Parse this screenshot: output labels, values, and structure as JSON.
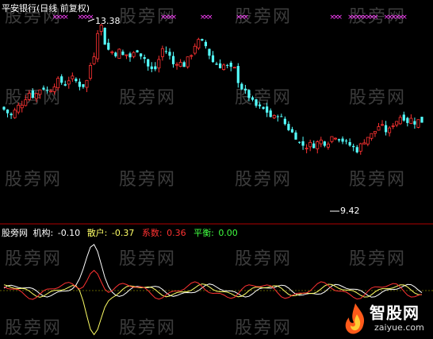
{
  "upper_header": {
    "title": "平安银行(日线 前复权)",
    "color": "#ffffff"
  },
  "annotations": {
    "high": "13.38",
    "low": "9.42"
  },
  "lower_header": {
    "name": "股旁网",
    "jigou_label": "机构:",
    "jigou_value": "-0.10",
    "sanhu_label": "散户:",
    "sanhu_value": "-0.37",
    "xishu_label": "系数:",
    "xishu_value": "0.36",
    "pingheng_label": "平衡:",
    "pingheng_value": "0.00"
  },
  "watermark_text": "股旁网",
  "logo": {
    "title": "智股网",
    "url": "zaiyue.com"
  },
  "colors": {
    "background": "#000000",
    "up": "#ff3232",
    "down": "#54ffff",
    "divider": "#b00000",
    "marker": "#ff40ff",
    "jigou": "#ffffff",
    "sanhu": "#ffff66",
    "xishu": "#ff3232",
    "pingheng": "#40ff40",
    "zero_line": "#c0c000"
  },
  "chart_data": [
    {
      "type": "candlestick",
      "title": "平安银行(日线 前复权)",
      "high_label": 13.38,
      "low_label": 9.42,
      "close_path": [
        11.55,
        11.48,
        11.42,
        11.52,
        11.62,
        11.68,
        11.8,
        11.9,
        11.84,
        11.88,
        11.98,
        12.0,
        11.94,
        11.98,
        12.08,
        12.15,
        12.12,
        12.08,
        12.18,
        12.2,
        12.14,
        12.06,
        12.05,
        12.15,
        12.48,
        12.7,
        13.2,
        13.3,
        12.95,
        12.8,
        12.76,
        12.72,
        12.78,
        12.68,
        12.7,
        12.65,
        12.72,
        12.8,
        12.7,
        12.62,
        12.45,
        12.38,
        12.4,
        12.6,
        12.82,
        12.78,
        12.66,
        12.5,
        12.55,
        12.52,
        12.48,
        12.6,
        12.72,
        12.9,
        12.98,
        12.95,
        12.88,
        12.7,
        12.55,
        12.5,
        12.46,
        12.48,
        12.45,
        12.4,
        12.4,
        12.15,
        12.0,
        11.9,
        11.82,
        11.7,
        11.62,
        11.58,
        11.55,
        11.5,
        11.4,
        11.38,
        11.45,
        11.36,
        11.25,
        11.15,
        11.06,
        10.98,
        10.85,
        10.8,
        10.78,
        10.82,
        10.8,
        10.86,
        10.9,
        10.85,
        10.88,
        10.98,
        11.0,
        10.95,
        10.9,
        10.85,
        10.8,
        10.75,
        10.7,
        10.8,
        10.9,
        10.98,
        11.02,
        11.1,
        11.2,
        11.18,
        11.1,
        11.12,
        11.25,
        11.32,
        11.4,
        11.38,
        11.3,
        11.35,
        11.28,
        11.32,
        11.3
      ],
      "markers_top": "purple x markers along the top edge",
      "panel": "upper"
    },
    {
      "type": "line",
      "series": [
        {
          "name": "机构",
          "color": "#ffffff",
          "last_value": -0.1
        },
        {
          "name": "散户",
          "color": "#ffff66",
          "last_value": -0.37
        },
        {
          "name": "系数",
          "color": "#ff3232",
          "last_value": 0.36
        },
        {
          "name": "平衡",
          "color": "#40ff40",
          "last_value": 0.0
        }
      ],
      "panel": "lower"
    }
  ]
}
